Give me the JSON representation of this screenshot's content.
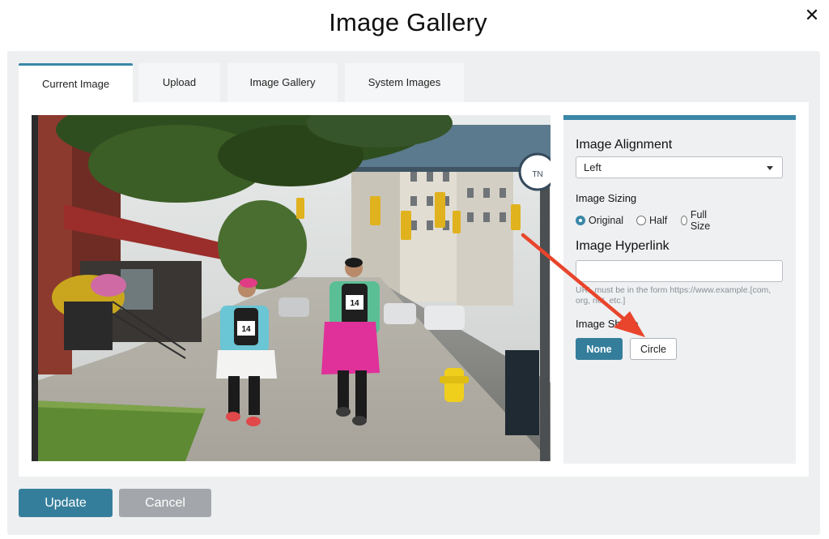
{
  "modal": {
    "title": "Image Gallery"
  },
  "tabs": [
    {
      "label": "Current Image",
      "active": true
    },
    {
      "label": "Upload"
    },
    {
      "label": "Image Gallery"
    },
    {
      "label": "System Images"
    }
  ],
  "settings": {
    "alignment": {
      "label": "Image Alignment",
      "value": "Left"
    },
    "sizing": {
      "label": "Image Sizing",
      "options": [
        "Original",
        "Half",
        "Full Size"
      ],
      "selected": "Original"
    },
    "hyperlink": {
      "label": "Image Hyperlink",
      "value": "",
      "help": "URL must be in the form https://www.example.[com, org, net, etc.]"
    },
    "shape": {
      "label": "Image Shape",
      "options": [
        "None",
        "Circle"
      ],
      "selected": "None"
    }
  },
  "footer": {
    "update_label": "Update",
    "cancel_label": "Cancel"
  },
  "photo": {
    "bib_numbers": [
      "14",
      "14"
    ],
    "sign_text": "TN"
  },
  "colors": {
    "accent": "#3b87a8",
    "primary_button": "#357e9b",
    "cancel_button": "#a3a7ab",
    "annotation_arrow": "#e8452c"
  },
  "icons": {
    "close": "close-icon",
    "dropdown": "chevron-down-icon"
  }
}
